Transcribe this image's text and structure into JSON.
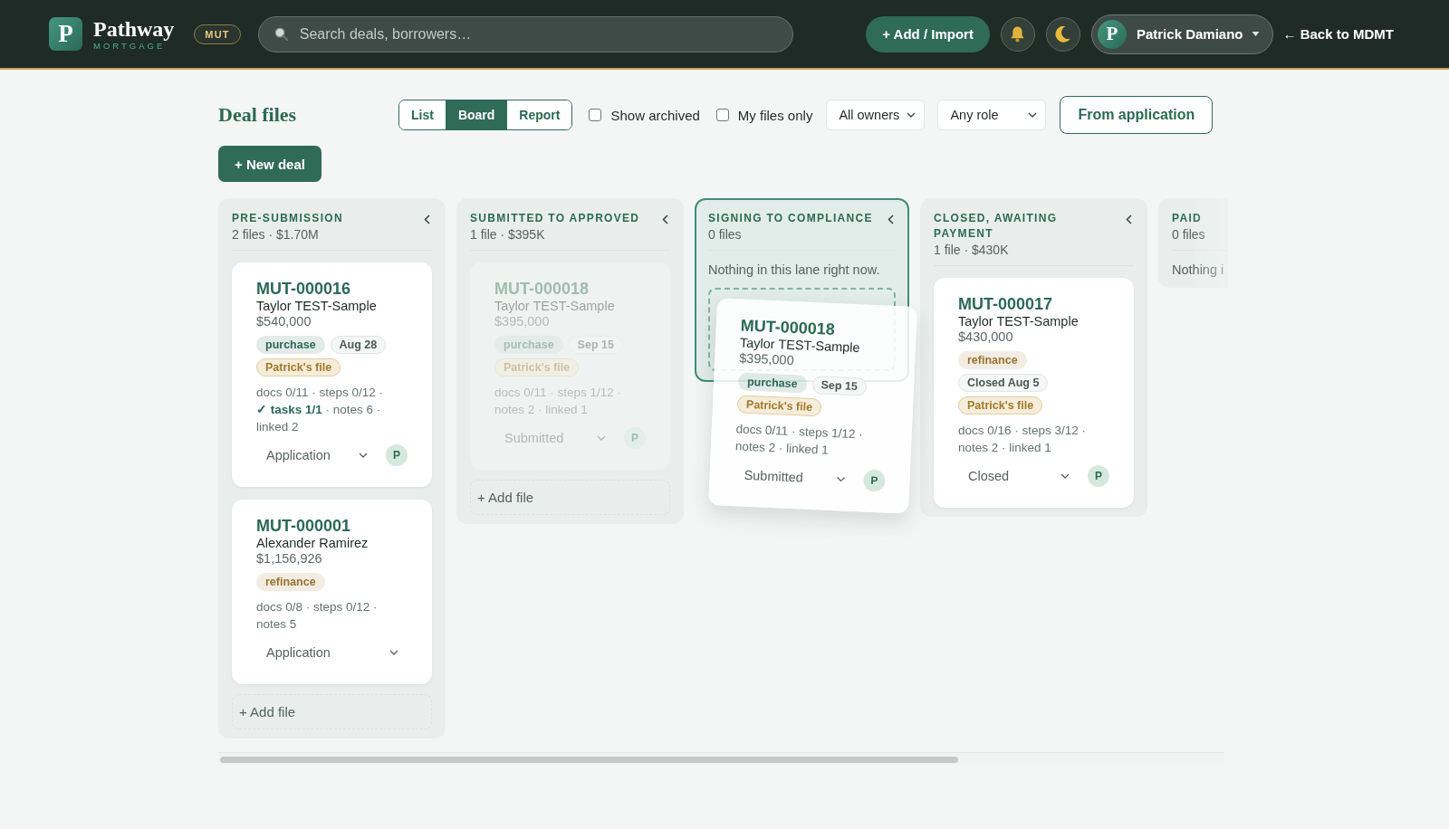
{
  "header": {
    "logo": "P",
    "brand": "Pathway",
    "tagline": "MORTGAGE",
    "company_badge": "MUT",
    "search": {
      "placeholder": "Search deals, borrowers…"
    },
    "add_button": "+ Add / Import",
    "user": {
      "initial": "P",
      "name": "Patrick Damiano"
    },
    "back_link": "← Back to MDMT"
  },
  "toolbar": {
    "title": "Deal files",
    "view_tabs": [
      {
        "label": "List",
        "selected": false
      },
      {
        "label": "Board",
        "selected": true
      },
      {
        "label": "Report",
        "selected": false
      }
    ],
    "filters": [
      {
        "label": "Show archived",
        "checked": false
      },
      {
        "label": "My files only",
        "checked": false
      }
    ],
    "selects": [
      {
        "value": "All owners"
      },
      {
        "value": "Any role"
      }
    ],
    "from_application_button": "From application",
    "new_deal_button": "+ New deal"
  },
  "lanes": [
    {
      "title": "PRE-SUBMISSION",
      "summary": "2 files · $1.70M",
      "highlighted": false,
      "collapsible": true,
      "cards": [
        {
          "id": "MUT-000016",
          "borrower": "Taylor TEST-Sample",
          "amount": "$540,000",
          "tags": [
            {
              "label": "purchase",
              "kind": "type",
              "color": "#2b6a52"
            },
            {
              "label": "Aug 28",
              "kind": "date"
            },
            {
              "label": "Patrick's file",
              "kind": "owner"
            }
          ],
          "stats": "docs 0/11 · steps 0/12 · **✓ tasks 1/1** · notes 6 · linked 2",
          "status": "Application",
          "owner_initial": "P",
          "ghost": false
        },
        {
          "id": "MUT-000001",
          "borrower": "Alexander Ramirez",
          "amount": "$1,156,926",
          "tags": [
            {
              "label": "refinance",
              "kind": "type",
              "color": "#9a7430"
            }
          ],
          "stats": "docs 0/8 · steps 0/12 · notes 5",
          "status": "Application",
          "ghost": false
        }
      ],
      "add_file": "+ Add file"
    },
    {
      "title": "SUBMITTED TO APPROVED",
      "summary": "1 file · $395K",
      "highlighted": false,
      "collapsible": true,
      "cards": [
        {
          "id": "MUT-000018",
          "borrower": "Taylor TEST-Sample",
          "amount": "$395,000",
          "tags": [
            {
              "label": "purchase",
              "kind": "type",
              "color": "#a3c0b4"
            },
            {
              "label": "Sep 15",
              "kind": "date"
            },
            {
              "label": "Patrick's file",
              "kind": "owner"
            }
          ],
          "stats": "docs 0/11 · steps 1/12 · notes 2 · linked 1",
          "status": "Submitted",
          "owner_initial": "P",
          "ghost": true
        }
      ],
      "add_file": "+ Add file"
    },
    {
      "title": "SIGNING TO COMPLIANCE",
      "summary": "0 files",
      "highlighted": true,
      "collapsible": true,
      "empty_text": "Nothing in this lane right now."
    },
    {
      "title": "CLOSED, AWAITING PAYMENT",
      "summary": "1 file · $430K",
      "highlighted": false,
      "collapsible": true,
      "cards": [
        {
          "id": "MUT-000017",
          "borrower": "Taylor TEST-Sample",
          "amount": "$430,000",
          "tags": [
            {
              "label": "refinance",
              "kind": "type",
              "color": "#9a7430"
            },
            {
              "label": "Closed Aug 5",
              "kind": "date"
            },
            {
              "label": "Patrick's file",
              "kind": "owner"
            }
          ],
          "stats": "docs 0/16 · steps 3/12 · notes 2 · linked 1",
          "status": "Closed",
          "owner_initial": "P",
          "ghost": false
        }
      ]
    },
    {
      "title": "PAID",
      "summary": "0 files",
      "highlighted": false,
      "empty_text": "Nothing i"
    }
  ],
  "dragged_card": {
    "id": "MUT-000018",
    "borrower": "Taylor TEST-Sample",
    "amount": "$395,000",
    "tags": [
      {
        "label": "purchase",
        "kind": "type",
        "color": "#2b6a52"
      },
      {
        "label": "Sep 15",
        "kind": "date"
      },
      {
        "label": "Patrick's file",
        "kind": "owner"
      }
    ],
    "stats": "docs 0/11 · steps 1/12 · notes 2 · linked 1",
    "status": "Submitted",
    "owner_initial": "P"
  }
}
